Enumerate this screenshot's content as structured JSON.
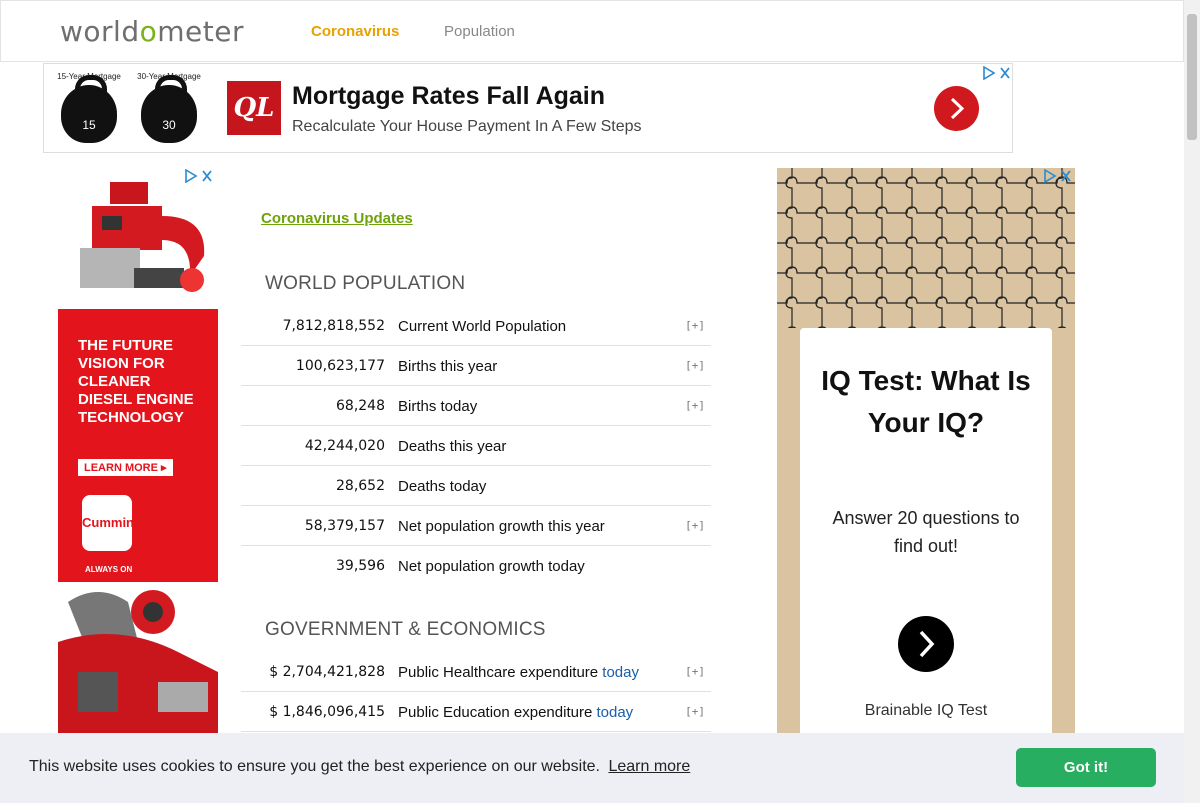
{
  "header": {
    "logo_left": "w",
    "logo_pre": "orld",
    "logo_o": "o",
    "logo_post": "meter",
    "nav": [
      {
        "label": "Coronavirus"
      },
      {
        "label": "Population"
      }
    ]
  },
  "top_ad": {
    "kettlebell_1_label": "15-Year Mortgage",
    "kettlebell_1_num": "15",
    "kettlebell_2_label": "30-Year Mortgage",
    "kettlebell_2_num": "30",
    "brand": "QL",
    "headline": "Mortgage Rates Fall Again",
    "subline": "Recalculate Your House Payment In A Few Steps"
  },
  "left_ad": {
    "headline": "THE FUTURE VISION FOR CLEANER DIESEL ENGINE TECHNOLOGY",
    "cta": "LEARN MORE ▸",
    "brand": "Cummins",
    "tagline": "ALWAYS ON"
  },
  "main": {
    "updates_link": "Coronavirus Updates",
    "world_population": {
      "title": "WORLD POPULATION",
      "rows": [
        {
          "value": "7,812,818,552",
          "label": "Current World Population",
          "plus": "[+]"
        },
        {
          "value": "100,623,177",
          "label": "Births this year",
          "plus": "[+]"
        },
        {
          "value": "68,248",
          "label": "Births today",
          "plus": "[+]"
        },
        {
          "value": "42,244,020",
          "label": "Deaths this year",
          "plus": ""
        },
        {
          "value": "28,652",
          "label": "Deaths today",
          "plus": ""
        },
        {
          "value": "58,379,157",
          "label": "Net population growth this year",
          "plus": "[+]"
        },
        {
          "value": "39,596",
          "label": "Net population growth today",
          "plus": ""
        }
      ]
    },
    "government": {
      "title": "GOVERNMENT & ECONOMICS",
      "rows": [
        {
          "value": "$ 2,704,421,828",
          "label": "Public Healthcare expenditure",
          "today": "today",
          "plus": "[+]"
        },
        {
          "value": "$ 1,846,096,415",
          "label": "Public Education expenditure",
          "today": "today",
          "plus": "[+]"
        }
      ]
    }
  },
  "right_ad": {
    "headline": "IQ Test: What Is Your IQ?",
    "subline": "Answer 20 questions to find out!",
    "brand": "Brainable IQ Test"
  },
  "cookie": {
    "message": "This website uses cookies to ensure you get the best experience on our website.",
    "learn_more": "Learn more",
    "accept": "Got it!"
  },
  "colors": {
    "accent_orange": "#e8a200",
    "accent_green": "#6ea20a",
    "link_blue": "#1a5ea8",
    "cookie_button": "#27ae60",
    "ad_red": "#e3141b"
  }
}
